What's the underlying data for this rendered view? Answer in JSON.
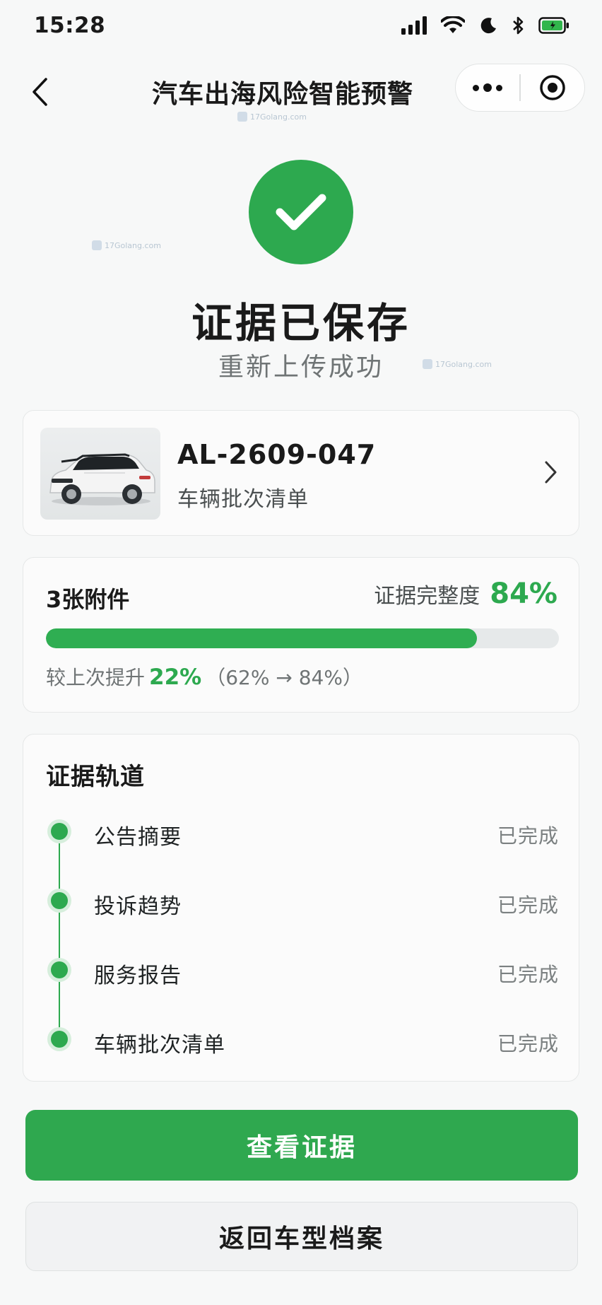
{
  "status_bar": {
    "time": "15:28"
  },
  "nav": {
    "title": "汽车出海风险智能预警"
  },
  "watermark": "17Golang.com",
  "result": {
    "title": "证据已保存",
    "subtitle": "重新上传成功"
  },
  "vehicle": {
    "code": "AL-2609-047",
    "name": "车辆批次清单"
  },
  "evidence": {
    "attachments_label": "3张附件",
    "completeness_label": "证据完整度",
    "completeness_value": "84%",
    "completeness_fraction": 0.84,
    "improve_prefix": "较上次提升",
    "improve_pct": "22%",
    "improve_detail": "（62% → 84%）"
  },
  "track": {
    "title": "证据轨道",
    "items": [
      {
        "label": "公告摘要",
        "status": "已完成"
      },
      {
        "label": "投诉趋势",
        "status": "已完成"
      },
      {
        "label": "服务报告",
        "status": "已完成"
      },
      {
        "label": "车辆批次清单",
        "status": "已完成"
      }
    ]
  },
  "buttons": {
    "primary": "查看证据",
    "secondary": "返回车型档案"
  },
  "colors": {
    "accent": "#2da94f",
    "progress_track": "#e6e9ea"
  }
}
